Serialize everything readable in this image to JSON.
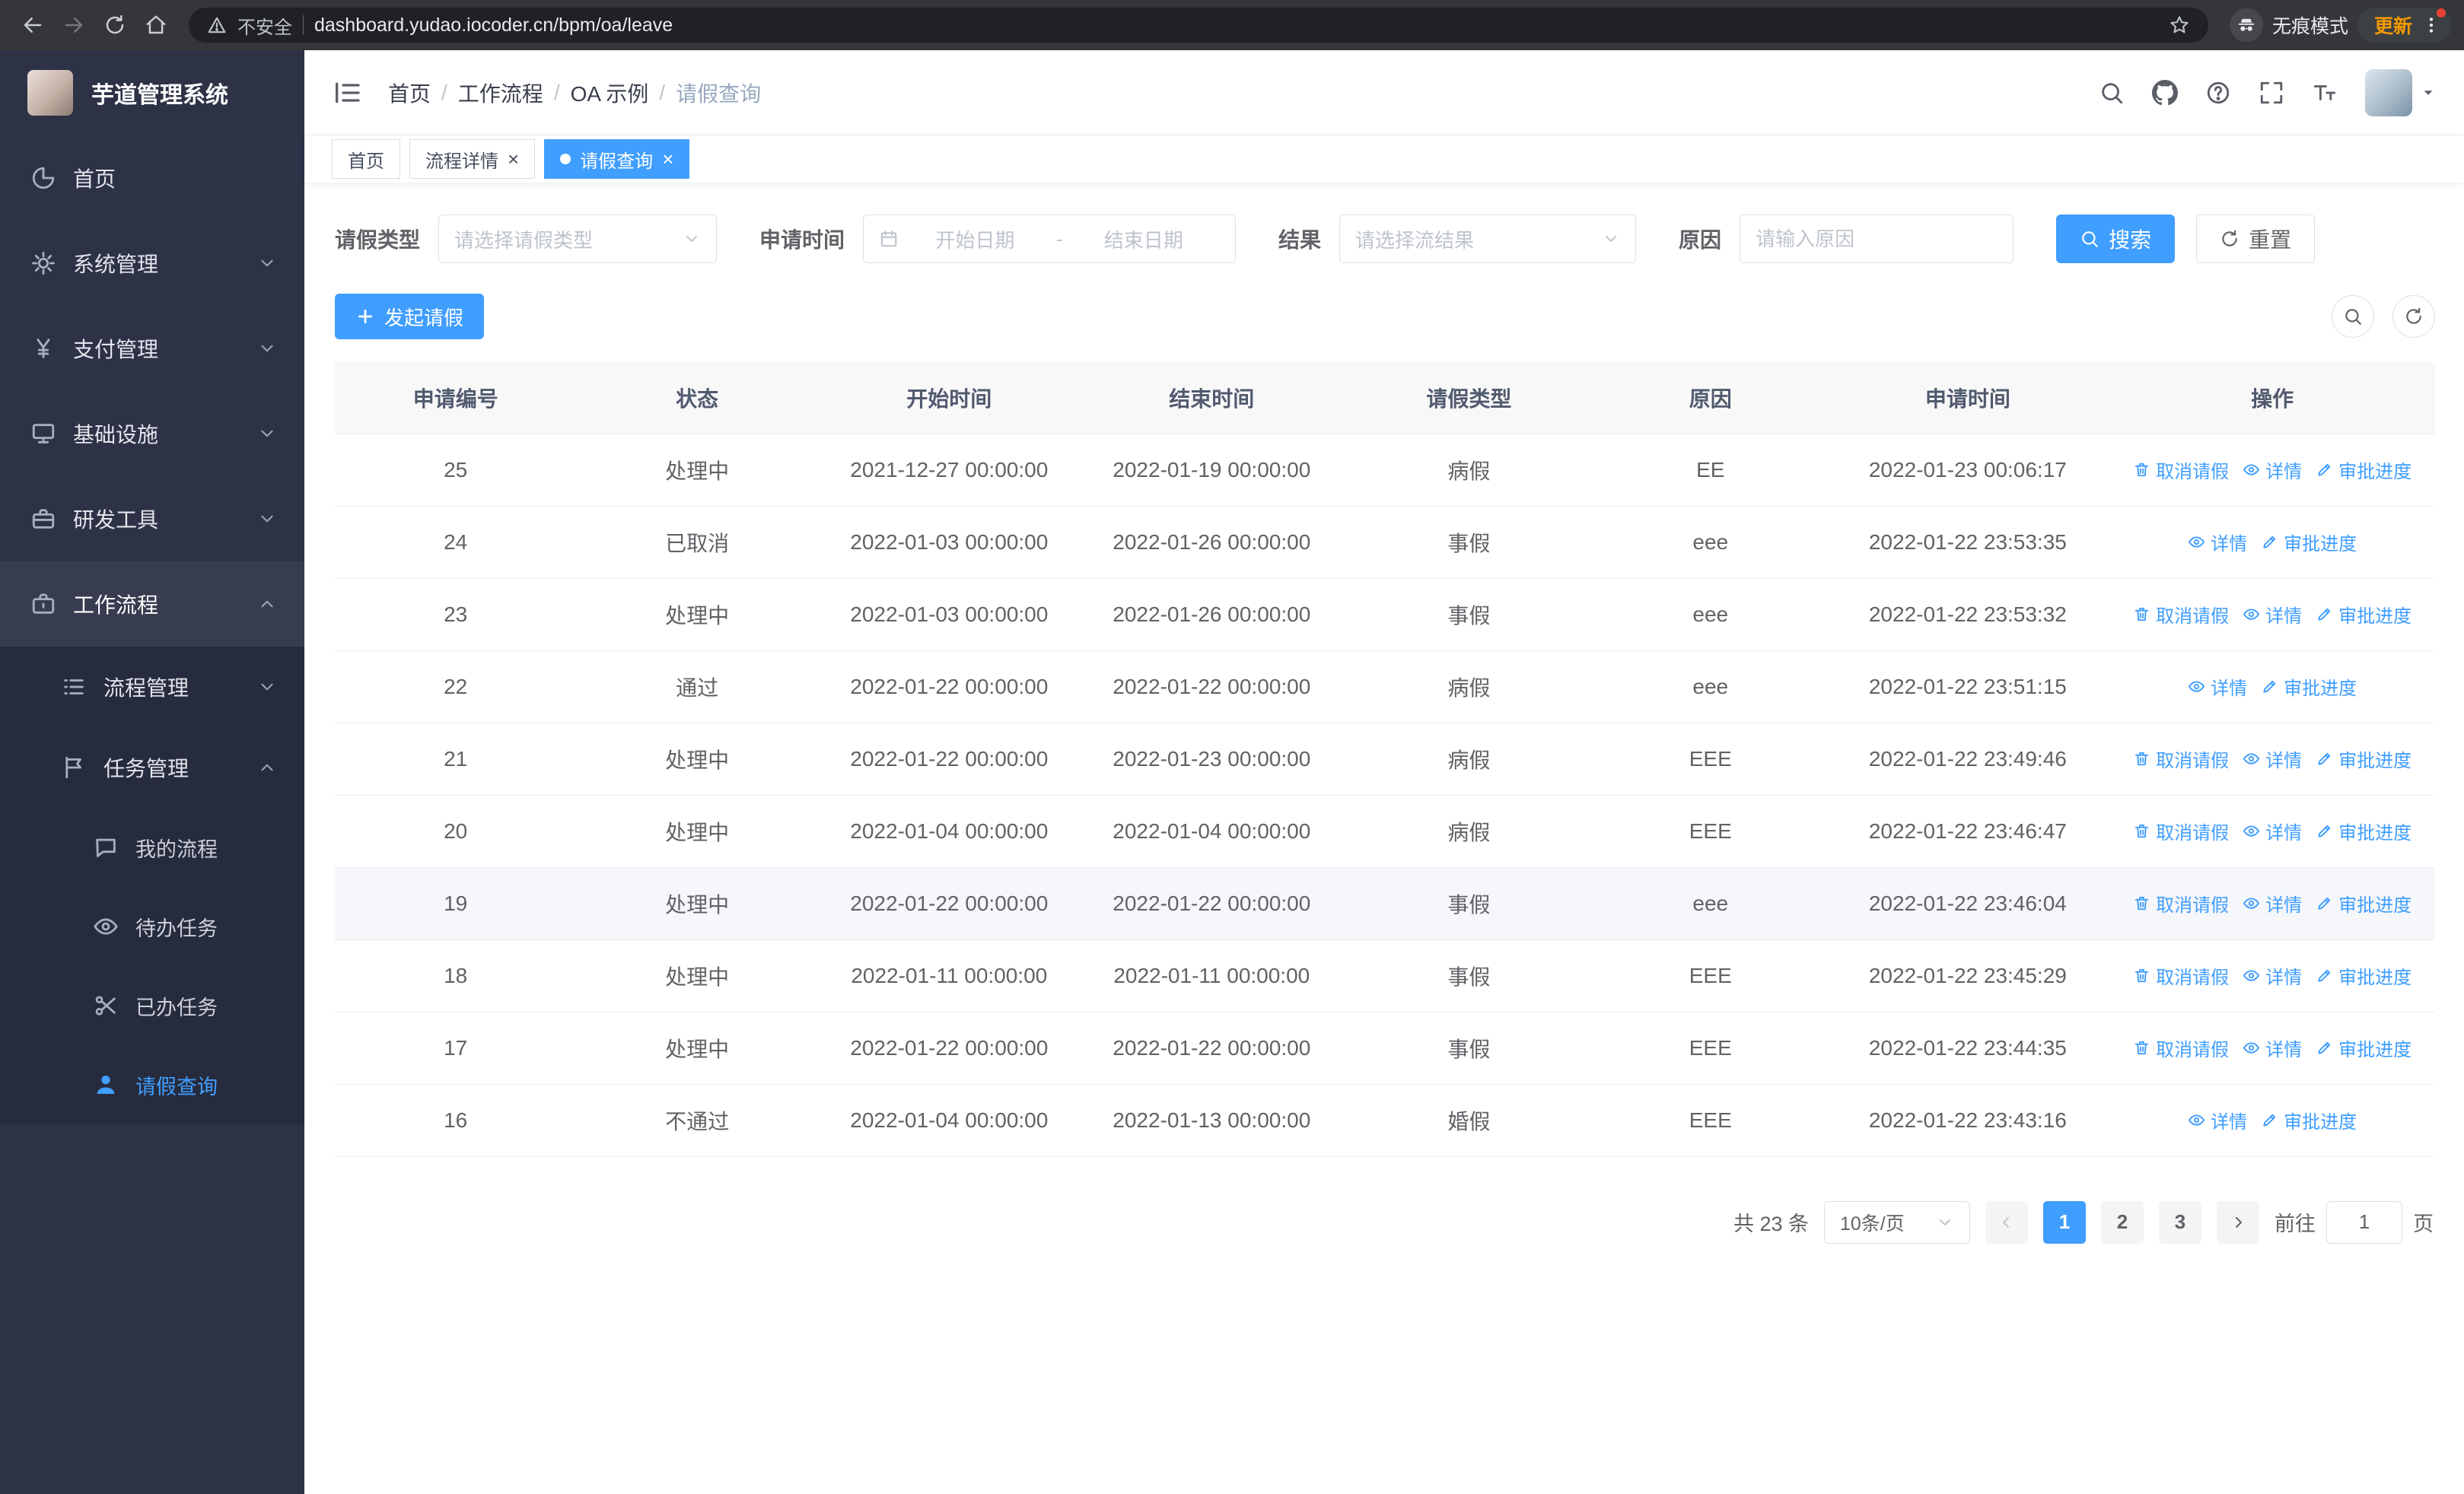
{
  "colors": {
    "accent": "#409eff",
    "sidebar_bg": "#2d3247",
    "submenu_bg": "#262b3e",
    "browser_bar_bg": "#35363a",
    "update_text": "#f29900"
  },
  "browser": {
    "security_label": "不安全",
    "url": "dashboard.yudao.iocoder.cn/bpm/oa/leave",
    "incognito_label": "无痕模式",
    "update_label": "更新",
    "nav_icons": [
      "back-arrow-icon",
      "forward-arrow-icon",
      "reload-icon",
      "home-icon"
    ]
  },
  "sidebar": {
    "app_title": "芋道管理系统",
    "menu": [
      {
        "name": "home",
        "label": "首页",
        "icon": "pie-chart-icon"
      },
      {
        "name": "system-management",
        "label": "系统管理",
        "icon": "gear-icon",
        "chevron": "down"
      },
      {
        "name": "payment-management",
        "label": "支付管理",
        "icon": "yen-icon",
        "chevron": "down"
      },
      {
        "name": "infrastructure",
        "label": "基础设施",
        "icon": "monitor-icon",
        "chevron": "down"
      },
      {
        "name": "dev-tools",
        "label": "研发工具",
        "icon": "toolbox-icon",
        "chevron": "down"
      },
      {
        "name": "workflow",
        "label": "工作流程",
        "icon": "briefcase-icon",
        "chevron": "up",
        "expanded": true,
        "children": [
          {
            "name": "process-management",
            "label": "流程管理",
            "icon": "list-icon",
            "chevron": "down"
          },
          {
            "name": "task-management",
            "label": "任务管理",
            "icon": "flag-icon",
            "chevron": "up",
            "expanded": true,
            "children": [
              {
                "name": "my-processes",
                "label": "我的流程",
                "icon": "chat-icon"
              },
              {
                "name": "todo-tasks",
                "label": "待办任务",
                "icon": "eye-icon"
              },
              {
                "name": "done-tasks",
                "label": "已办任务",
                "icon": "scissors-icon"
              },
              {
                "name": "leave-query",
                "label": "请假查询",
                "icon": "user-icon",
                "active": true
              }
            ]
          }
        ]
      }
    ]
  },
  "header": {
    "breadcrumb": [
      "首页",
      "工作流程",
      "OA 示例",
      "请假查询"
    ],
    "icons": [
      "search-icon",
      "github-icon",
      "question-icon",
      "fullscreen-icon",
      "font-size-icon"
    ]
  },
  "tabs": [
    {
      "label": "首页",
      "closable": false,
      "active": false
    },
    {
      "label": "流程详情",
      "closable": true,
      "active": false
    },
    {
      "label": "请假查询",
      "closable": true,
      "active": true
    }
  ],
  "filters": {
    "leave_type_label": "请假类型",
    "leave_type_placeholder": "请选择请假类型",
    "apply_time_label": "申请时间",
    "start_date_placeholder": "开始日期",
    "range_separator": "-",
    "end_date_placeholder": "结束日期",
    "result_label": "结果",
    "result_placeholder": "请选择流结果",
    "reason_label": "原因",
    "reason_placeholder": "请输入原因",
    "search_label": "搜索",
    "reset_label": "重置"
  },
  "toolbar": {
    "create_label": "发起请假"
  },
  "table": {
    "columns": [
      "申请编号",
      "状态",
      "开始时间",
      "结束时间",
      "请假类型",
      "原因",
      "申请时间",
      "操作"
    ],
    "action_labels": {
      "cancel": "取消请假",
      "detail": "详情",
      "progress": "审批进度"
    },
    "rows": [
      {
        "id": "25",
        "status": "处理中",
        "start": "2021-12-27 00:00:00",
        "end": "2022-01-19 00:00:00",
        "type": "病假",
        "reason": "EE",
        "applied": "2022-01-23 00:06:17",
        "actions": [
          "cancel",
          "detail",
          "progress"
        ]
      },
      {
        "id": "24",
        "status": "已取消",
        "start": "2022-01-03 00:00:00",
        "end": "2022-01-26 00:00:00",
        "type": "事假",
        "reason": "eee",
        "applied": "2022-01-22 23:53:35",
        "actions": [
          "detail",
          "progress"
        ]
      },
      {
        "id": "23",
        "status": "处理中",
        "start": "2022-01-03 00:00:00",
        "end": "2022-01-26 00:00:00",
        "type": "事假",
        "reason": "eee",
        "applied": "2022-01-22 23:53:32",
        "actions": [
          "cancel",
          "detail",
          "progress"
        ]
      },
      {
        "id": "22",
        "status": "通过",
        "start": "2022-01-22 00:00:00",
        "end": "2022-01-22 00:00:00",
        "type": "病假",
        "reason": "eee",
        "applied": "2022-01-22 23:51:15",
        "actions": [
          "detail",
          "progress"
        ]
      },
      {
        "id": "21",
        "status": "处理中",
        "start": "2022-01-22 00:00:00",
        "end": "2022-01-23 00:00:00",
        "type": "病假",
        "reason": "EEE",
        "applied": "2022-01-22 23:49:46",
        "actions": [
          "cancel",
          "detail",
          "progress"
        ]
      },
      {
        "id": "20",
        "status": "处理中",
        "start": "2022-01-04 00:00:00",
        "end": "2022-01-04 00:00:00",
        "type": "病假",
        "reason": "EEE",
        "applied": "2022-01-22 23:46:47",
        "actions": [
          "cancel",
          "detail",
          "progress"
        ]
      },
      {
        "id": "19",
        "status": "处理中",
        "start": "2022-01-22 00:00:00",
        "end": "2022-01-22 00:00:00",
        "type": "事假",
        "reason": "eee",
        "applied": "2022-01-22 23:46:04",
        "actions": [
          "cancel",
          "detail",
          "progress"
        ],
        "highlighted": true
      },
      {
        "id": "18",
        "status": "处理中",
        "start": "2022-01-11 00:00:00",
        "end": "2022-01-11 00:00:00",
        "type": "事假",
        "reason": "EEE",
        "applied": "2022-01-22 23:45:29",
        "actions": [
          "cancel",
          "detail",
          "progress"
        ]
      },
      {
        "id": "17",
        "status": "处理中",
        "start": "2022-01-22 00:00:00",
        "end": "2022-01-22 00:00:00",
        "type": "事假",
        "reason": "EEE",
        "applied": "2022-01-22 23:44:35",
        "actions": [
          "cancel",
          "detail",
          "progress"
        ]
      },
      {
        "id": "16",
        "status": "不通过",
        "start": "2022-01-04 00:00:00",
        "end": "2022-01-13 00:00:00",
        "type": "婚假",
        "reason": "EEE",
        "applied": "2022-01-22 23:43:16",
        "actions": [
          "detail",
          "progress"
        ]
      }
    ]
  },
  "pagination": {
    "total": "共 23 条",
    "page_size": "10条/页",
    "pages": [
      "1",
      "2",
      "3"
    ],
    "active_page": "1",
    "goto_label": "前往",
    "goto_value": "1",
    "page_unit": "页"
  }
}
